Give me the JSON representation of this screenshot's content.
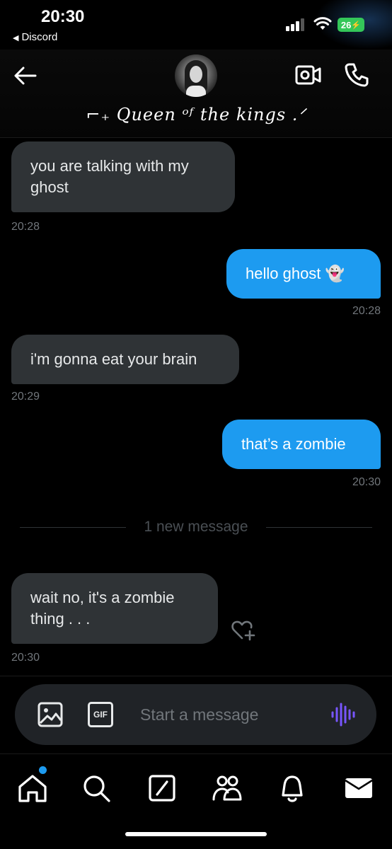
{
  "status_bar": {
    "time": "20:30",
    "back_app": "Discord",
    "battery": "26"
  },
  "header": {
    "display_name": "⌐₊ Queen ᵒᶠ the kings .ᐟ"
  },
  "messages": [
    {
      "direction": "incoming",
      "lines": [
        "you are talking with my",
        "ghost"
      ],
      "time": "20:28"
    },
    {
      "direction": "outgoing",
      "lines": [
        "hello ghost 👻"
      ],
      "time": "20:28"
    },
    {
      "direction": "incoming",
      "lines": [
        "i'm gonna eat your brain"
      ],
      "time": "20:29"
    },
    {
      "direction": "outgoing",
      "lines": [
        "that’s a zombie"
      ],
      "time": "20:30"
    },
    {
      "direction": "incoming",
      "lines": [
        "wait no, it's a zombie",
        "thing . . ."
      ],
      "time": "20:30"
    }
  ],
  "divider": {
    "text": "1 new message"
  },
  "composer": {
    "placeholder": "Start a message",
    "gif_label": "GIF"
  },
  "icons": {
    "back": "arrow-left-icon",
    "video": "video-camera-icon",
    "phone": "phone-icon",
    "image": "image-icon",
    "gif": "gif-icon",
    "voice": "voice-waveform-icon",
    "react": "heart-plus-icon",
    "nav": [
      "home-icon",
      "search-icon",
      "grok-icon",
      "communities-icon",
      "notifications-icon",
      "messages-icon"
    ]
  },
  "colors": {
    "accent": "#1d9bf0",
    "incoming_bubble": "#2f3336",
    "voice": "#7856ff",
    "battery": "#34c759"
  }
}
